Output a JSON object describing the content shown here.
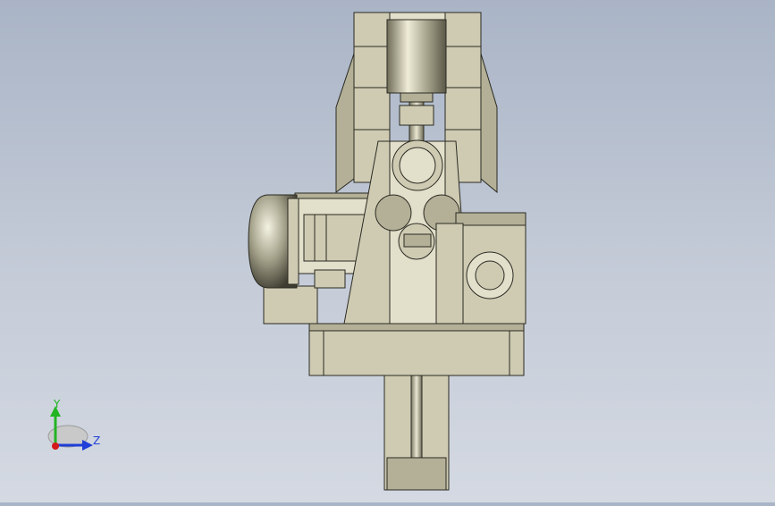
{
  "viewport": {
    "background_top": "#a9b4c6",
    "background_bottom": "#d4d9e2",
    "model_color": "#cfcbb3",
    "edge_color": "#2a2a22"
  },
  "triad": {
    "y_label": "Y",
    "z_label": "Z",
    "x_color": "#d41a1a",
    "y_color": "#22b422",
    "z_color": "#1f3fd8"
  },
  "icons": {
    "triad": "axis-triad-icon",
    "model": "assembly-model"
  }
}
